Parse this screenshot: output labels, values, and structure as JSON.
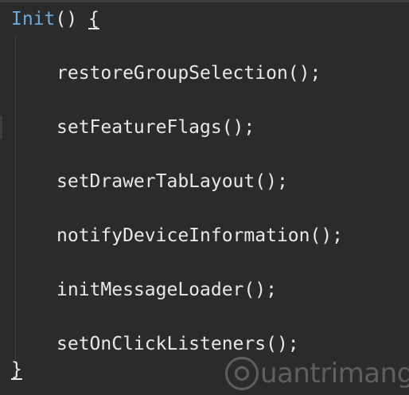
{
  "code": {
    "function_name": "Init",
    "parens": "()",
    "open_brace": "{",
    "close_brace": "}",
    "statements": [
      "restoreGroupSelection();",
      "setFeatureFlags();",
      "setDrawerTabLayout();",
      "notifyDeviceInformation();",
      "initMessageLoader();",
      "setOnClickListeners();"
    ]
  },
  "watermark": {
    "text": "uantrimang"
  },
  "colors": {
    "background": "#2b2b2b",
    "function_name": "#6aa9dc",
    "text": "#e8e8e8"
  }
}
